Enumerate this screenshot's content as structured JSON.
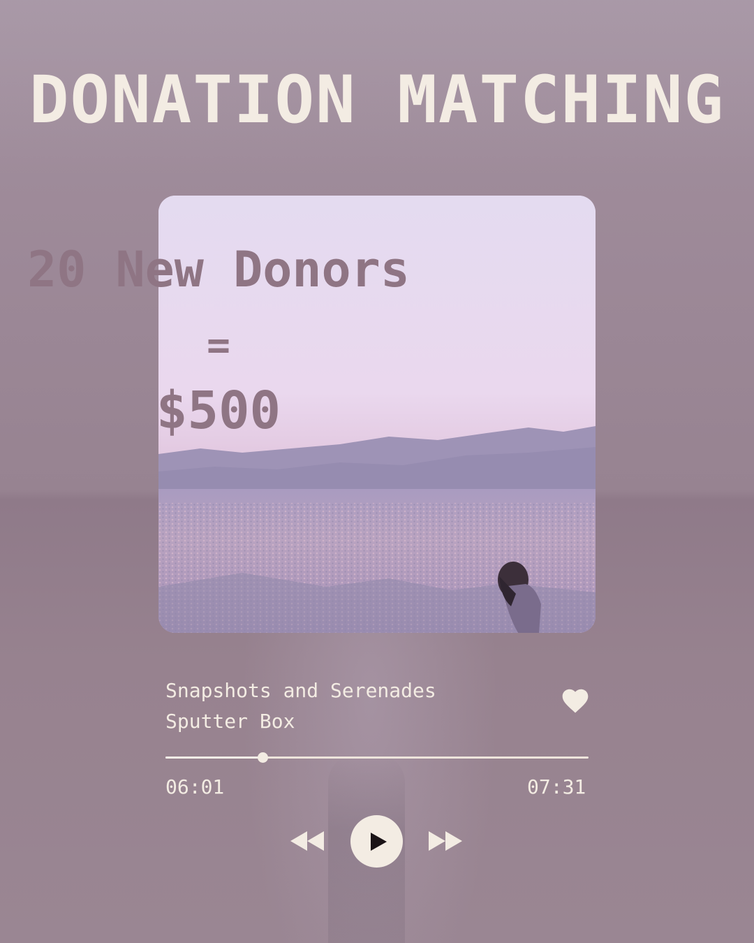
{
  "heading": {
    "title": "DONATION MATCHING"
  },
  "card": {
    "headline": "20 New Donors",
    "equals": "=",
    "amount": "$500"
  },
  "player": {
    "track_title": "Snapshots and Serenades",
    "artist": "Sputter Box",
    "elapsed": "06:01",
    "total": "07:31",
    "progress_fraction": 0.23,
    "liked": true,
    "icons": {
      "like": "heart-icon",
      "previous": "rewind-icon",
      "play": "play-icon",
      "next": "fast-forward-icon"
    }
  },
  "colors": {
    "text_light": "#f3ece3",
    "card_text": "#8f7584",
    "background": "#9a8593"
  }
}
